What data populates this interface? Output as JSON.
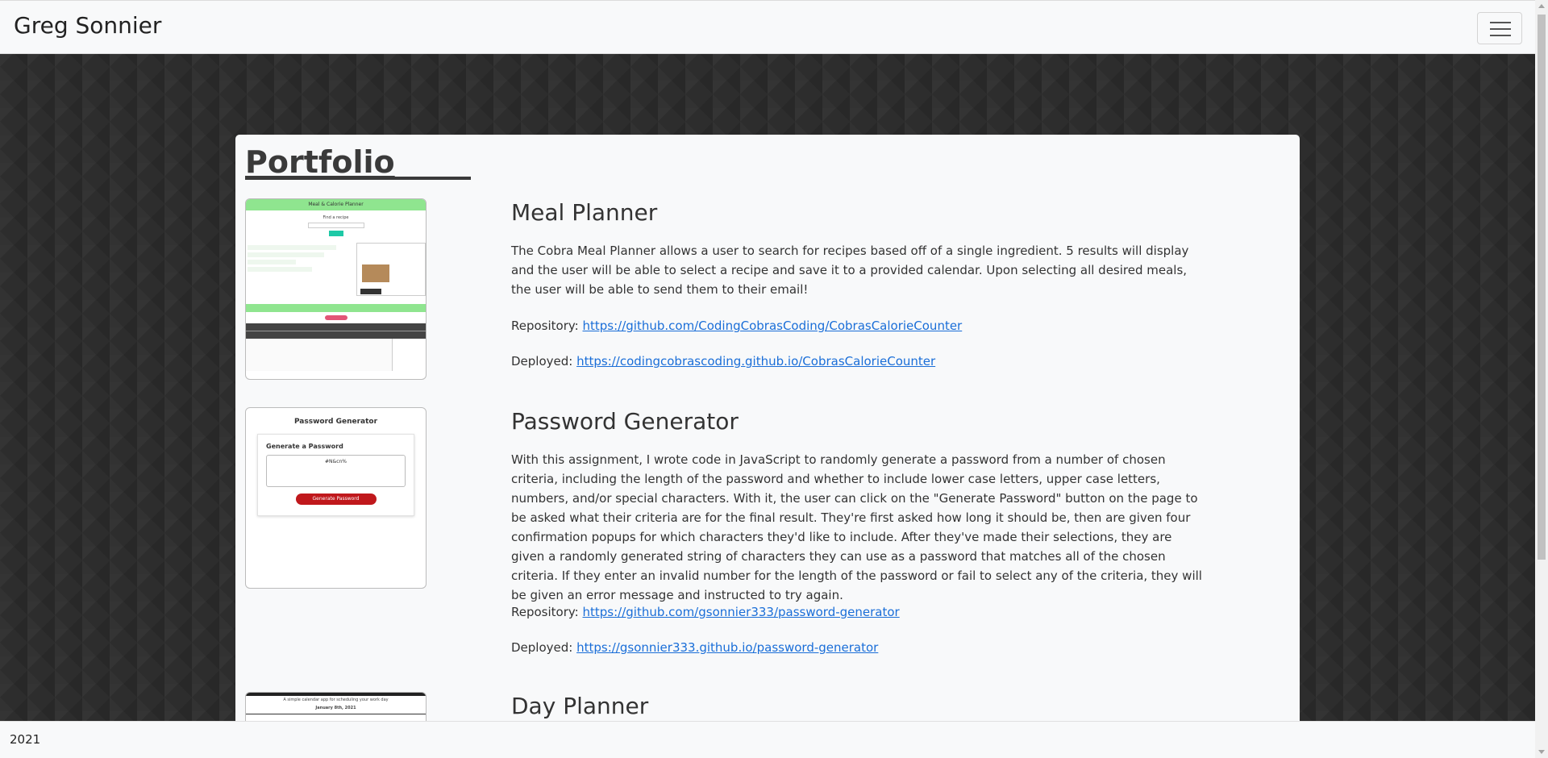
{
  "navbar": {
    "brand": "Greg Sonnier"
  },
  "page": {
    "title": "Portfolio"
  },
  "projects": [
    {
      "title": "Meal Planner",
      "description": "The Cobra Meal Planner allows a user to search for recipes based off of a single ingredient. 5 results will display and the user will be able to select a recipe and save it to a provided calendar. Upon selecting all desired meals, the user will be able to send them to their email!",
      "repo_label": "Repository: ",
      "repo_url": "https://github.com/CodingCobrasCoding/CobrasCalorieCounter",
      "deployed_label": "Deployed: ",
      "deployed_url": "https://codingcobrascoding.github.io/CobrasCalorieCounter",
      "thumbnail": {
        "header": "Meal & Calorie Planner",
        "search_label": "Find a recipe"
      }
    },
    {
      "title": "Password Generator",
      "description": "With this assignment, I wrote code in JavaScript to randomly generate a password from a number of chosen criteria, including the length of the password and whether to include lower case letters, upper case letters, numbers, and/or special characters. With it, the user can click on the \"Generate Password\" button on the page to be asked what their criteria are for the final result. They're first asked how long it should be, then are given four confirmation popups for which characters they'd like to include. After they've made their selections, they are given a randomly generated string of characters they can use as a password that matches all of the chosen criteria. If they enter an invalid number for the length of the password or fail to select any of the criteria, they will be given an error message and instructed to try again.",
      "repo_label": "Repository: ",
      "repo_url": "https://github.com/gsonnier333/password-generator",
      "deployed_label": "Deployed: ",
      "deployed_url": "https://gsonnier333.github.io/password-generator",
      "thumbnail": {
        "title": "Password Generator",
        "card_header": "Generate a Password",
        "output": "#N&cn%",
        "button": "Generate Password"
      }
    },
    {
      "title": "Day Planner",
      "thumbnail": {
        "subtitle": "A simple calendar app for scheduling your work day",
        "date": "January 8th, 2021"
      }
    }
  ],
  "footer": {
    "text": "2021"
  },
  "colors": {
    "link": "#1a6ed8",
    "navbar_bg": "#f8f9fa",
    "page_bg": "#2d2d2d",
    "card_bg": "#f8f9fa"
  }
}
